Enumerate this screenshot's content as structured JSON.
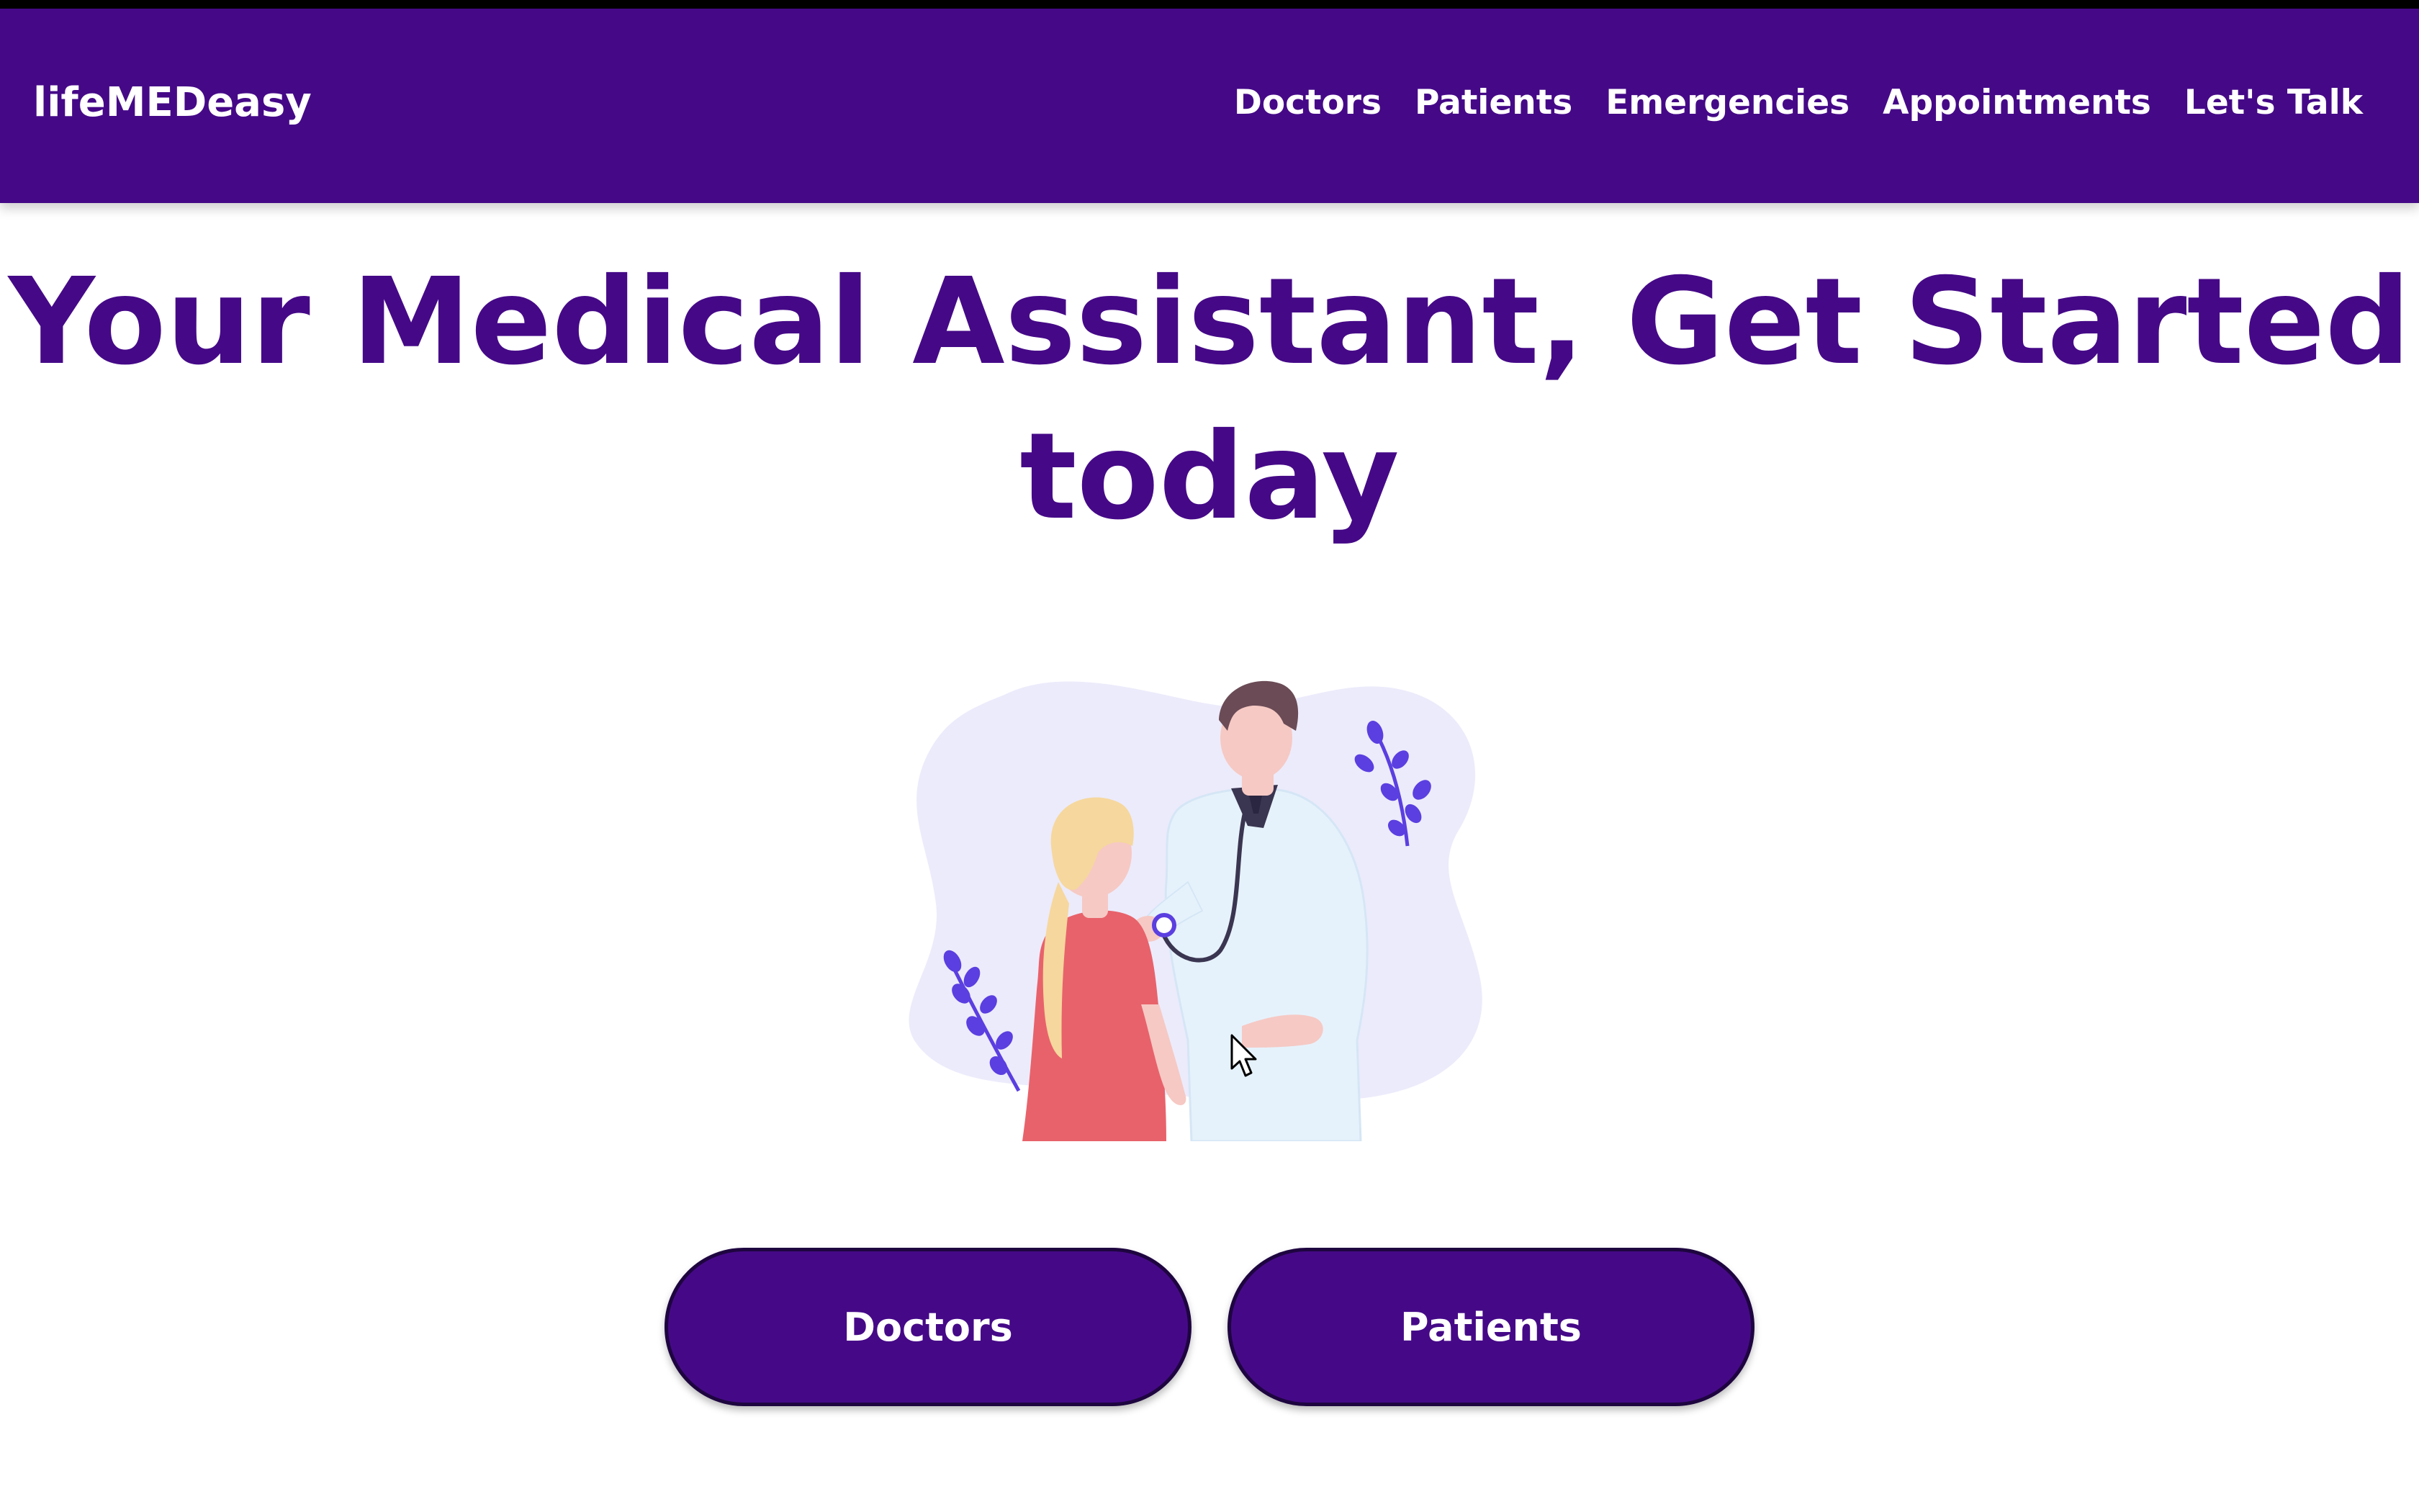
{
  "brand": {
    "name": "lifeMEDeasy"
  },
  "nav": {
    "items": [
      {
        "label": "Doctors"
      },
      {
        "label": "Patients"
      },
      {
        "label": "Emergencies"
      },
      {
        "label": "Appointments"
      },
      {
        "label": "Let's Talk"
      }
    ]
  },
  "hero": {
    "title_line1": "Your Medical Assistant, Get Started",
    "title_line2": "today",
    "illustration": "doctor-patient-illustration"
  },
  "cta": {
    "doctors_label": "Doctors",
    "patients_label": "Patients"
  },
  "colors": {
    "primary": "#450987",
    "background": "#ffffff",
    "text_on_primary": "#ffffff",
    "leaf_accent": "#5b3fe0",
    "blob": "#ecebfb"
  }
}
